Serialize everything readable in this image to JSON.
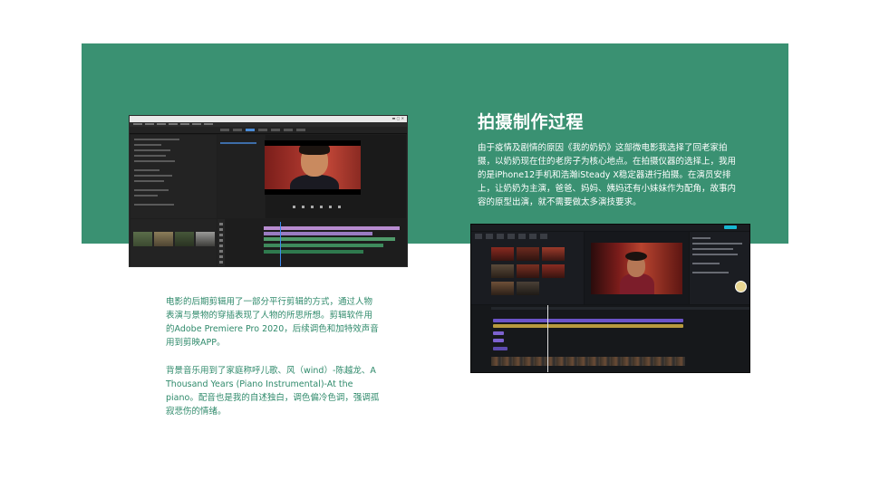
{
  "slide": {
    "title": "拍摄制作过程",
    "intro": "由于疫情及剧情的原因《我的奶奶》这部微电影我选择了回老家拍摄，以奶奶现在住的老房子为核心地点。在拍摄仪器的选择上，我用的是iPhone12手机和浩瀚iSteady X稳定器进行拍摄。在演员安排上，让奶奶为主演，爸爸、妈妈、姨妈还有小妹妹作为配角，故事内容的原型出演，就不需要做太多演技要求。",
    "editing_note": "电影的后期剪辑用了一部分平行剪辑的方式，通过人物表演与景物的穿插表现了人物的所思所想。剪辑软件用的Adobe Premiere Pro 2020，后续调色和加特效声音用到剪映APP。",
    "music_note": "背景音乐用到了家庭称呼儿歌、风（wind）-陈越龙、A Thousand Years (Piano Instrumental)-At the piano。配音也是我的自述独白，调色偏冷色调，强调孤寂悲伤的情绪。",
    "colors": {
      "band": "#3a9172",
      "note_text": "#2f8a6b",
      "title_text": "#ffffff"
    }
  },
  "screenshots": {
    "premiere": {
      "app": "Adobe Premiere Pro 2020"
    },
    "jianying": {
      "app": "剪映"
    }
  }
}
